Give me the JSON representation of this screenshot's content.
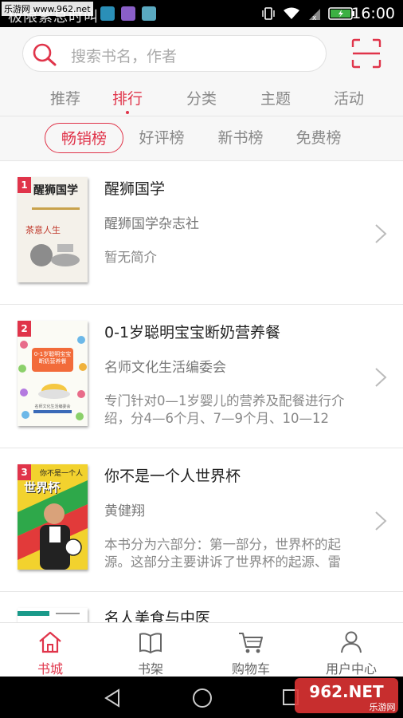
{
  "status_bar": {
    "carrier": "极限紫总时叫",
    "watermark": "乐游网 www.962.net",
    "time": "16:00",
    "app_icon_colors": [
      "#2a8fb8",
      "#8a5fc8",
      "#5aa9c0"
    ]
  },
  "search": {
    "placeholder": "搜索书名，作者"
  },
  "top_tabs": [
    {
      "label": "推荐",
      "active": false
    },
    {
      "label": "排行",
      "active": true
    },
    {
      "label": "分类",
      "active": false
    },
    {
      "label": "主题",
      "active": false
    },
    {
      "label": "活动",
      "active": false
    }
  ],
  "sub_tabs": [
    {
      "label": "畅销榜",
      "active": true
    },
    {
      "label": "好评榜",
      "active": false
    },
    {
      "label": "新书榜",
      "active": false
    },
    {
      "label": "免费榜",
      "active": false
    }
  ],
  "books": [
    {
      "rank": "1",
      "title": "醒狮国学",
      "author": "醒狮国学杂志社",
      "desc": "暂无简介",
      "cover_title": "醒狮国学",
      "cover_sub": "茶意人生"
    },
    {
      "rank": "2",
      "title": "0-1岁聪明宝宝断奶营养餐",
      "author": "名师文化生活编委会",
      "desc": "专门针对0—1岁婴儿的营养及配餐进行介绍，分4—6个月、7—9个月、10—12",
      "cover_title": "0-1岁聪明宝宝断奶营养餐",
      "cover_sub": "名师文化生活编委会"
    },
    {
      "rank": "3",
      "title": "你不是一个人世界杯",
      "author": "黄健翔",
      "desc": "本书分为六部分：第一部分，世界杯的起源。这部分主要讲诉了世界杯的起源、雷",
      "cover_title": "世界杯",
      "cover_sub": "你不是一个人"
    },
    {
      "rank": "",
      "title": "名人美食与中医",
      "author": "",
      "desc": "",
      "cover_title": "",
      "cover_sub": ""
    }
  ],
  "bottom_nav": [
    {
      "label": "书城",
      "icon": "home-icon",
      "active": true
    },
    {
      "label": "书架",
      "icon": "book-icon",
      "active": false
    },
    {
      "label": "购物车",
      "icon": "cart-icon",
      "active": false
    },
    {
      "label": "用户中心",
      "icon": "user-icon",
      "active": false
    }
  ],
  "watermark_br": {
    "brand": "962.NET",
    "site": "乐游网"
  },
  "colors": {
    "accent": "#e0344a",
    "text_gray": "#888888"
  }
}
